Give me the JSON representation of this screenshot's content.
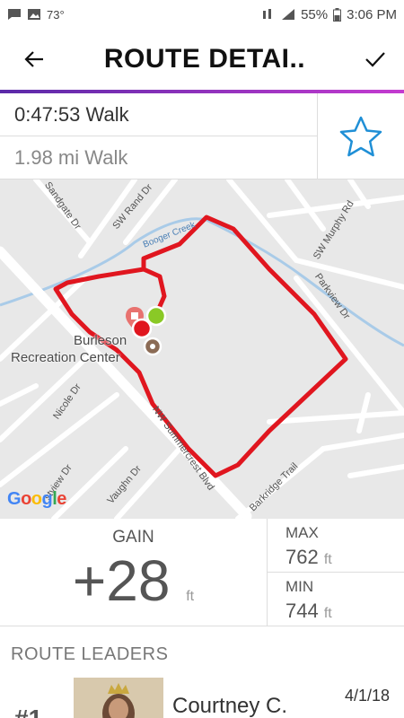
{
  "status_bar": {
    "temperature": "73°",
    "battery": "55%",
    "time": "3:06 PM"
  },
  "app_bar": {
    "title": "ROUTE DETAI.."
  },
  "summary": {
    "duration_activity": "0:47:53 Walk",
    "distance_activity": "1.98 mi Walk"
  },
  "map": {
    "streets": {
      "sandgate": "Sandgate Dr",
      "sw_rand": "SW Rand Dr",
      "booger_creek": "Booger Creek",
      "sw_murphy": "SW Murphy Rd",
      "parkview": "Parkview Dr",
      "nicole": "Nicole Dr",
      "summercrest": "NW Summercrest Blvd",
      "stview": "stview Dr",
      "vaughn": "Vaughn Dr",
      "barkridge": "Barkridge Trail"
    },
    "poi": "Burleson\nRecreation Center",
    "attribution": "Google"
  },
  "elevation": {
    "gain_label": "GAIN",
    "gain_value": "+28",
    "gain_unit": "ft",
    "max_label": "MAX",
    "max_value": "762",
    "max_unit": "ft",
    "min_label": "MIN",
    "min_value": "744",
    "min_unit": "ft"
  },
  "leaders": {
    "heading": "ROUTE LEADERS",
    "items": [
      {
        "rank": "#1",
        "name": "Courtney C.",
        "date": "4/1/18"
      }
    ]
  },
  "colors": {
    "route": "#e0161f",
    "accent_start": "#5a2aa8",
    "accent_end": "#c43bd0",
    "star": "#1f8fd6"
  }
}
